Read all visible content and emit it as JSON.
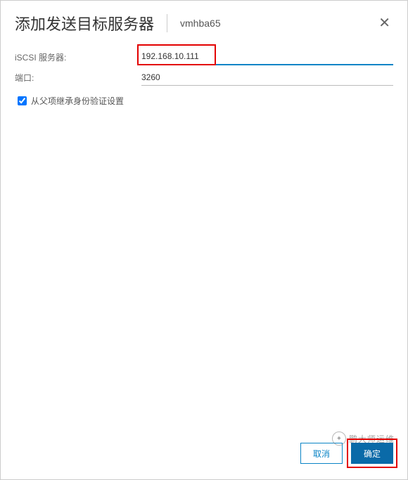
{
  "header": {
    "title": "添加发送目标服务器",
    "subtitle": "vmhba65"
  },
  "form": {
    "server_label": "iSCSI 服务器:",
    "server_value": "192.168.10.111",
    "port_label": "端口:",
    "port_value": "3260",
    "inherit_label": "从父项继承身份验证设置"
  },
  "footer": {
    "cancel": "取消",
    "ok": "确定"
  },
  "watermark": {
    "text": "鹏大师运维"
  }
}
